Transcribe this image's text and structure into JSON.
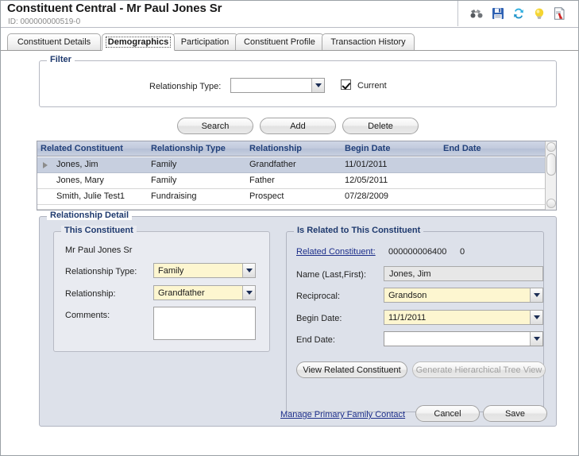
{
  "header": {
    "title": "Constituent Central - Mr Paul Jones Sr",
    "id_label": "ID: 000000000519-0",
    "toolbar": [
      {
        "name": "binoculars-icon",
        "label": "Search Records"
      },
      {
        "name": "save-icon",
        "label": "Save"
      },
      {
        "name": "refresh-icon",
        "label": "Refresh"
      },
      {
        "name": "lightbulb-icon",
        "label": "Tips"
      },
      {
        "name": "report-icon",
        "label": "Report"
      }
    ]
  },
  "tabs": [
    {
      "label": "Constituent Details",
      "active": false
    },
    {
      "label": "Demographics",
      "active": true
    },
    {
      "label": "Participation",
      "active": false
    },
    {
      "label": "Constituent Profile",
      "active": false
    },
    {
      "label": "Transaction History",
      "active": false
    }
  ],
  "filter": {
    "group_label": "Filter",
    "relationship_type_label": "Relationship Type:",
    "relationship_type_value": "",
    "current_label": "Current",
    "current_checked": true
  },
  "actions": {
    "search": "Search",
    "add": "Add",
    "delete": "Delete"
  },
  "grid": {
    "columns": [
      "Related Constituent",
      "Relationship Type",
      "Relationship",
      "Begin Date",
      "End Date"
    ],
    "rows": [
      {
        "related_constituent": "Jones, Jim",
        "relationship_type": "Family",
        "relationship": "Grandfather",
        "begin_date": "11/01/2011",
        "end_date": "",
        "selected": true
      },
      {
        "related_constituent": "Jones, Mary",
        "relationship_type": "Family",
        "relationship": "Father",
        "begin_date": "12/05/2011",
        "end_date": "",
        "selected": false
      },
      {
        "related_constituent": "Smith, Julie Test1",
        "relationship_type": "Fundraising",
        "relationship": "Prospect",
        "begin_date": "07/28/2009",
        "end_date": "",
        "selected": false
      }
    ]
  },
  "detail": {
    "group_label": "Relationship Detail",
    "this_constituent": {
      "group_label": "This Constituent",
      "name": "Mr Paul Jones Sr",
      "relationship_type_label": "Relationship Type:",
      "relationship_type_value": "Family",
      "relationship_label": "Relationship:",
      "relationship_value": "Grandfather",
      "comments_label": "Comments:",
      "comments_value": ""
    },
    "related": {
      "group_label": "Is Related to This Constituent",
      "related_constituent_link": "Related Constituent:",
      "related_constituent_id": "000000006400",
      "related_constituent_seq": "0",
      "name_label": "Name (Last,First):",
      "name_value": "Jones, Jim",
      "reciprocal_label": "Reciprocal:",
      "reciprocal_value": "Grandson",
      "begin_date_label": "Begin Date:",
      "begin_date_value": "11/1/2011",
      "end_date_label": "End Date:",
      "end_date_value": "",
      "view_related_button": "View Related Constituent",
      "generate_tree_button": "Generate Hierarchical Tree View"
    }
  },
  "footer": {
    "manage_primary_link": "Manage Primary Family Contact",
    "cancel": "Cancel",
    "save": "Save"
  },
  "colors": {
    "group_label": "#1f3a6e",
    "link": "#1c2e8a",
    "required_field": "#fdf6d0",
    "selected_row": "#c7cfdf",
    "panel": "#dde1ea"
  }
}
